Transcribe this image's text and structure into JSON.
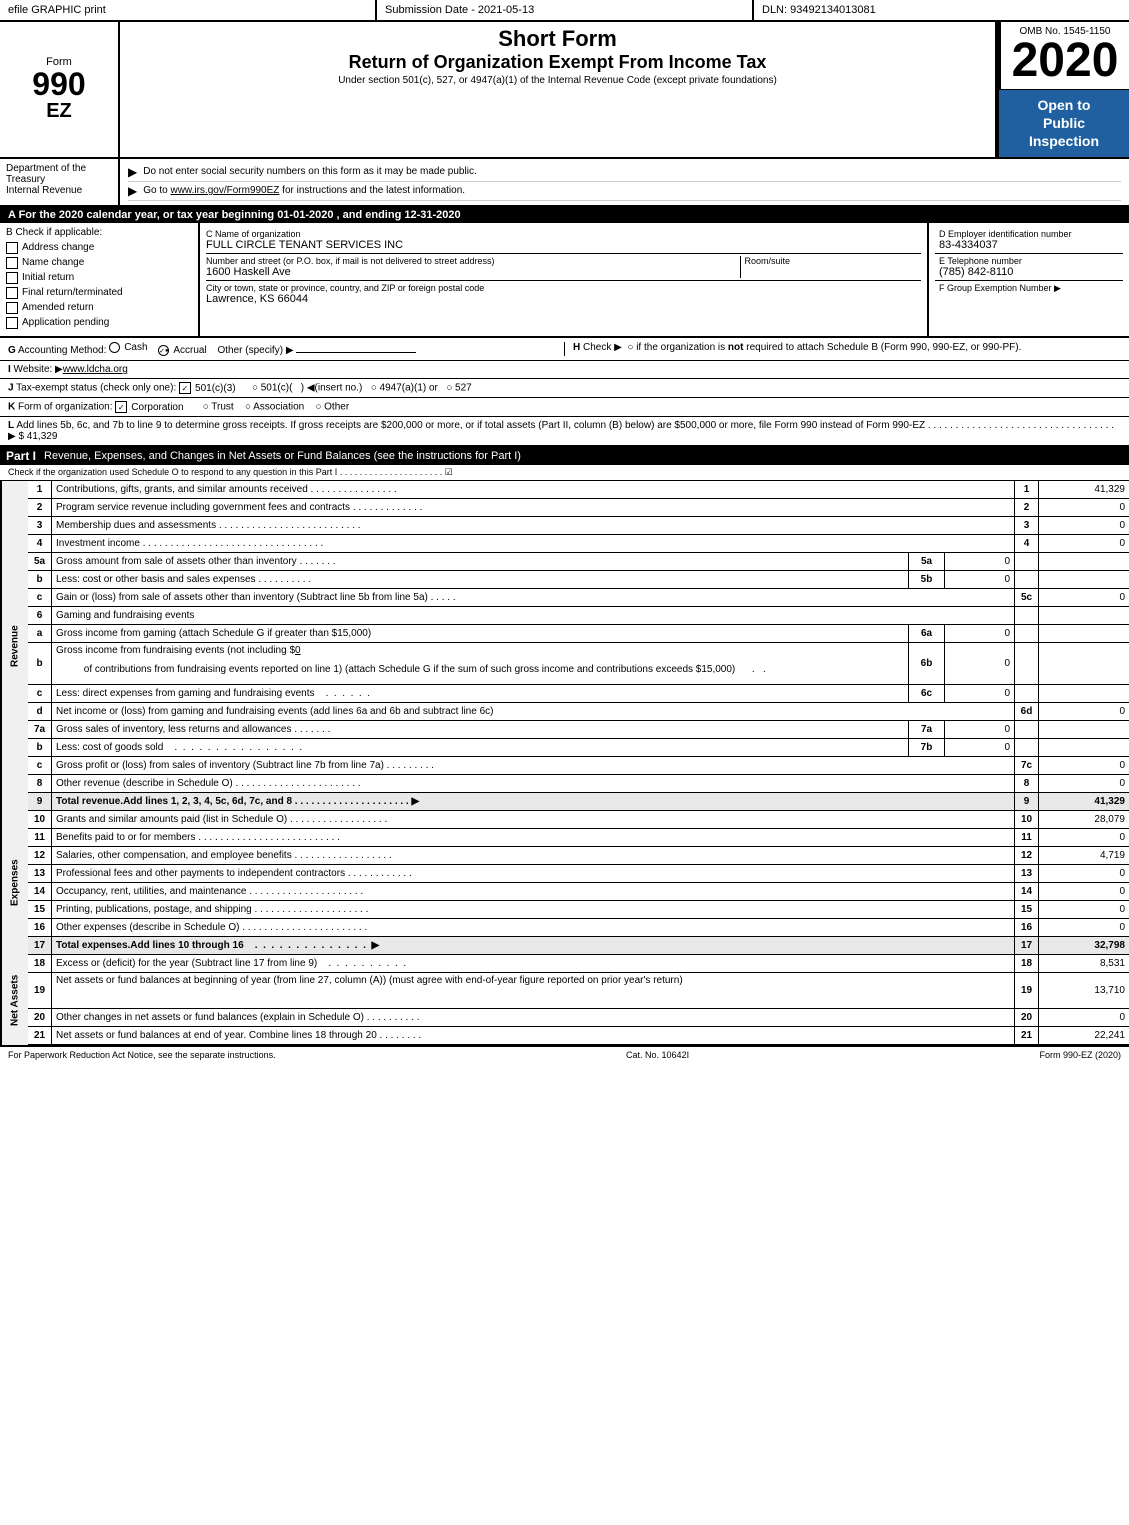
{
  "topBar": {
    "left": "efile GRAPHIC print",
    "mid": "Submission Date - 2021-05-13",
    "right": "DLN: 93492134013081"
  },
  "formLabel": {
    "form": "Form",
    "number": "990",
    "ez": "EZ"
  },
  "formTitle": {
    "shortForm": "Short Form",
    "returnTitle": "Return of Organization Exempt From Income Tax",
    "subtitle": "Under section 501(c), 527, or 4947(a)(1) of the Internal Revenue Code (except private foundations)"
  },
  "omb": {
    "label": "OMB No. 1545-1150",
    "year": "2020"
  },
  "openToPublic": {
    "line1": "Open to",
    "line2": "Public",
    "line3": "Inspection"
  },
  "instructions": {
    "line1": "▶ Do not enter social security numbers on this form as it may be made public.",
    "line2": "▶ Go to www.irs.gov/Form990EZ for instructions and the latest information."
  },
  "department": {
    "name": "Department of the Treasury",
    "division": "Internal Revenue"
  },
  "sectionA": {
    "label": "A For the 2020 calendar year, or tax year beginning 01-01-2020 , and ending 12-31-2020"
  },
  "checkboxes": {
    "header": "B Check if applicable:",
    "items": [
      {
        "label": "Address change",
        "checked": false
      },
      {
        "label": "Name change",
        "checked": false
      },
      {
        "label": "Initial return",
        "checked": false
      },
      {
        "label": "Final return/terminated",
        "checked": false
      },
      {
        "label": "Amended return",
        "checked": false
      },
      {
        "label": "Application pending",
        "checked": false
      }
    ]
  },
  "orgName": {
    "label": "C Name of organization",
    "value": "FULL CIRCLE TENANT SERVICES INC"
  },
  "street": {
    "label": "Number and street (or P.O. box, if mail is not delivered to street address)",
    "value": "1600 Haskell Ave",
    "roomLabel": "Room/suite",
    "roomValue": ""
  },
  "cityState": {
    "label": "City or town, state or province, country, and ZIP or foreign postal code",
    "value": "Lawrence, KS 66044"
  },
  "ein": {
    "label": "D Employer identification number",
    "value": "83-4334037"
  },
  "phone": {
    "label": "E Telephone number",
    "value": "(785) 842-8110"
  },
  "groupExemption": {
    "label": "F Group Exemption Number",
    "value": "▶"
  },
  "accountingMethod": {
    "label": "G Accounting Method:",
    "cash": "Cash",
    "accrual": "Accrual",
    "accrualChecked": true,
    "other": "Other (specify) ▶",
    "otherValue": ""
  },
  "checkH": {
    "text": "H Check ▶  ○ if the organization is not required to attach Schedule B (Form 990, 990-EZ, or 990-PF)."
  },
  "website": {
    "label": "I Website: ▶www.ldcha.org"
  },
  "taxExempt": {
    "label": "J Tax-exempt status (check only one):",
    "options": [
      "501(c)(3)",
      "501(c)(  ) ◀(insert no.)",
      "4947(a)(1) or",
      "527"
    ],
    "checked501c3": true
  },
  "formOrg": {
    "label": "K Form of organization:",
    "options": [
      "Corporation",
      "Trust",
      "Association",
      "Other"
    ],
    "checkedCorp": true
  },
  "lineL": {
    "text": "L Add lines 5b, 6c, and 7b to line 9 to determine gross receipts. If gross receipts are $200,000 or more, or if total assets (Part II, column (B) below) are $500,000 or more, file Form 990 instead of Form 990-EZ . . . . . . . . . . . . . . . . . . . . . . . . . . . . . . . . . . ▶ $ 41,329"
  },
  "partI": {
    "label": "Part I",
    "title": "Revenue, Expenses, and Changes in Net Assets or Fund Balances",
    "titleSuffix": "(see the instructions for Part I)",
    "checkRow": "Check if the organization used Schedule O to respond to any question in this Part I . . . . . . . . . . . . . . . . . . . . .",
    "checkMark": "☑"
  },
  "revenueRows": [
    {
      "num": "1",
      "desc": "Contributions, gifts, grants, and similar amounts received",
      "amount": "41,329"
    },
    {
      "num": "2",
      "desc": "Program service revenue including government fees and contracts",
      "amount": "0"
    },
    {
      "num": "3",
      "desc": "Membership dues and assessments",
      "amount": "0"
    },
    {
      "num": "4",
      "desc": "Investment income",
      "amount": "0"
    },
    {
      "num": "5a",
      "desc": "Gross amount from sale of assets other than inventory",
      "midLabel": "5a",
      "midVal": "0"
    },
    {
      "num": "b",
      "desc": "Less: cost or other basis and sales expenses",
      "midLabel": "5b",
      "midVal": "0"
    },
    {
      "num": "c",
      "desc": "Gain or (loss) from sale of assets other than inventory (Subtract line 5b from line 5a)",
      "lineNum": "5c",
      "amount": "0"
    }
  ],
  "gamingRows": [
    {
      "num": "6",
      "desc": "Gaming and fundraising events"
    },
    {
      "num": "a",
      "desc": "Gross income from gaming (attach Schedule G if greater than $15,000)",
      "midLabel": "6a",
      "midVal": "0"
    },
    {
      "num": "b",
      "desc": "Gross income from fundraising events (not including $ 0 of contributions from fundraising events reported on line 1) (attach Schedule G if the sum of such gross income and contributions exceeds $15,000)",
      "midLabel": "6b",
      "midVal": "0"
    },
    {
      "num": "c",
      "desc": "Less: direct expenses from gaming and fundraising events",
      "midLabel": "6c",
      "midVal": "0"
    },
    {
      "num": "d",
      "desc": "Net income or (loss) from gaming and fundraising events (add lines 6a and 6b and subtract line 6c)",
      "lineNum": "6d",
      "amount": "0"
    },
    {
      "num": "7a",
      "desc": "Gross sales of inventory, less returns and allowances",
      "midLabel": "7a",
      "midVal": "0"
    },
    {
      "num": "b",
      "desc": "Less: cost of goods sold",
      "midLabel": "7b",
      "midVal": "0"
    },
    {
      "num": "c",
      "desc": "Gross profit or (loss) from sales of inventory (Subtract line 7b from line 7a)",
      "lineNum": "7c",
      "amount": "0"
    },
    {
      "num": "8",
      "desc": "Other revenue (describe in Schedule O)",
      "amount": "0"
    }
  ],
  "totalRevenue": {
    "num": "9",
    "desc": "Total revenue. Add lines 1, 2, 3, 4, 5c, 6d, 7c, and 8",
    "amount": "41,329",
    "arrow": "▶"
  },
  "expenseRows": [
    {
      "num": "10",
      "desc": "Grants and similar amounts paid (list in Schedule O)",
      "amount": "28,079"
    },
    {
      "num": "11",
      "desc": "Benefits paid to or for members",
      "amount": "0"
    },
    {
      "num": "12",
      "desc": "Salaries, other compensation, and employee benefits",
      "amount": "4,719"
    },
    {
      "num": "13",
      "desc": "Professional fees and other payments to independent contractors",
      "amount": "0"
    },
    {
      "num": "14",
      "desc": "Occupancy, rent, utilities, and maintenance",
      "amount": "0"
    },
    {
      "num": "15",
      "desc": "Printing, publications, postage, and shipping",
      "amount": "0"
    },
    {
      "num": "16",
      "desc": "Other expenses (describe in Schedule O)",
      "amount": "0"
    }
  ],
  "totalExpenses": {
    "num": "17",
    "desc": "Total expenses. Add lines 10 through 16",
    "amount": "32,798",
    "arrow": "▶"
  },
  "netAssetRows": [
    {
      "num": "18",
      "desc": "Excess or (deficit) for the year (Subtract line 17 from line 9)",
      "amount": "8,531"
    },
    {
      "num": "19",
      "desc": "Net assets or fund balances at beginning of year (from line 27, column (A)) (must agree with end-of-year figure reported on prior year's return)",
      "amount": "13,710"
    },
    {
      "num": "20",
      "desc": "Other changes in net assets or fund balances (explain in Schedule O)",
      "amount": "0"
    },
    {
      "num": "21",
      "desc": "Net assets or fund balances at end of year. Combine lines 18 through 20",
      "amount": "22,241"
    }
  ],
  "footer": {
    "left": "For Paperwork Reduction Act Notice, see the separate instructions.",
    "mid": "Cat. No. 10642I",
    "right": "Form 990-EZ (2020)"
  }
}
